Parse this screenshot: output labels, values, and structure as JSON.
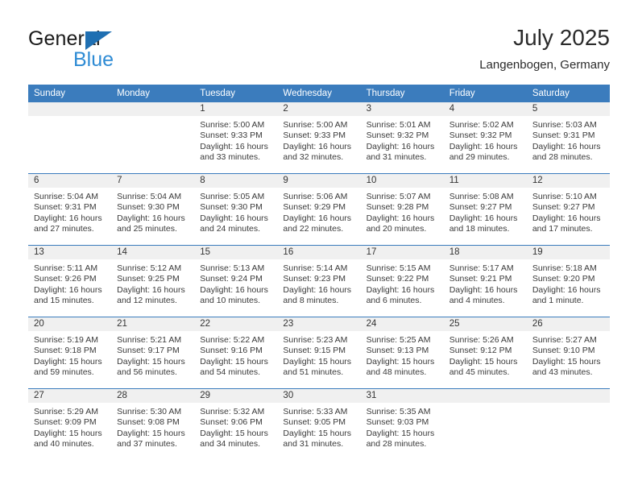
{
  "brand": {
    "word_general": "General",
    "word_blue": "Blue",
    "triangle_color": "#1f6fb2",
    "blue_text_color": "#2e8bd4"
  },
  "header": {
    "title": "July 2025",
    "location": "Langenbogen, Germany",
    "header_bg": "#3b7cbd",
    "header_text": "#ffffff",
    "date_band_bg": "#f0f0f0"
  },
  "weekday_headers": [
    "Sunday",
    "Monday",
    "Tuesday",
    "Wednesday",
    "Thursday",
    "Friday",
    "Saturday"
  ],
  "weeks": [
    [
      {
        "empty": true
      },
      {
        "empty": true
      },
      {
        "day": "1",
        "sunrise": "Sunrise: 5:00 AM",
        "sunset": "Sunset: 9:33 PM",
        "daylight": "Daylight: 16 hours and 33 minutes."
      },
      {
        "day": "2",
        "sunrise": "Sunrise: 5:00 AM",
        "sunset": "Sunset: 9:33 PM",
        "daylight": "Daylight: 16 hours and 32 minutes."
      },
      {
        "day": "3",
        "sunrise": "Sunrise: 5:01 AM",
        "sunset": "Sunset: 9:32 PM",
        "daylight": "Daylight: 16 hours and 31 minutes."
      },
      {
        "day": "4",
        "sunrise": "Sunrise: 5:02 AM",
        "sunset": "Sunset: 9:32 PM",
        "daylight": "Daylight: 16 hours and 29 minutes."
      },
      {
        "day": "5",
        "sunrise": "Sunrise: 5:03 AM",
        "sunset": "Sunset: 9:31 PM",
        "daylight": "Daylight: 16 hours and 28 minutes."
      }
    ],
    [
      {
        "day": "6",
        "sunrise": "Sunrise: 5:04 AM",
        "sunset": "Sunset: 9:31 PM",
        "daylight": "Daylight: 16 hours and 27 minutes."
      },
      {
        "day": "7",
        "sunrise": "Sunrise: 5:04 AM",
        "sunset": "Sunset: 9:30 PM",
        "daylight": "Daylight: 16 hours and 25 minutes."
      },
      {
        "day": "8",
        "sunrise": "Sunrise: 5:05 AM",
        "sunset": "Sunset: 9:30 PM",
        "daylight": "Daylight: 16 hours and 24 minutes."
      },
      {
        "day": "9",
        "sunrise": "Sunrise: 5:06 AM",
        "sunset": "Sunset: 9:29 PM",
        "daylight": "Daylight: 16 hours and 22 minutes."
      },
      {
        "day": "10",
        "sunrise": "Sunrise: 5:07 AM",
        "sunset": "Sunset: 9:28 PM",
        "daylight": "Daylight: 16 hours and 20 minutes."
      },
      {
        "day": "11",
        "sunrise": "Sunrise: 5:08 AM",
        "sunset": "Sunset: 9:27 PM",
        "daylight": "Daylight: 16 hours and 18 minutes."
      },
      {
        "day": "12",
        "sunrise": "Sunrise: 5:10 AM",
        "sunset": "Sunset: 9:27 PM",
        "daylight": "Daylight: 16 hours and 17 minutes."
      }
    ],
    [
      {
        "day": "13",
        "sunrise": "Sunrise: 5:11 AM",
        "sunset": "Sunset: 9:26 PM",
        "daylight": "Daylight: 16 hours and 15 minutes."
      },
      {
        "day": "14",
        "sunrise": "Sunrise: 5:12 AM",
        "sunset": "Sunset: 9:25 PM",
        "daylight": "Daylight: 16 hours and 12 minutes."
      },
      {
        "day": "15",
        "sunrise": "Sunrise: 5:13 AM",
        "sunset": "Sunset: 9:24 PM",
        "daylight": "Daylight: 16 hours and 10 minutes."
      },
      {
        "day": "16",
        "sunrise": "Sunrise: 5:14 AM",
        "sunset": "Sunset: 9:23 PM",
        "daylight": "Daylight: 16 hours and 8 minutes."
      },
      {
        "day": "17",
        "sunrise": "Sunrise: 5:15 AM",
        "sunset": "Sunset: 9:22 PM",
        "daylight": "Daylight: 16 hours and 6 minutes."
      },
      {
        "day": "18",
        "sunrise": "Sunrise: 5:17 AM",
        "sunset": "Sunset: 9:21 PM",
        "daylight": "Daylight: 16 hours and 4 minutes."
      },
      {
        "day": "19",
        "sunrise": "Sunrise: 5:18 AM",
        "sunset": "Sunset: 9:20 PM",
        "daylight": "Daylight: 16 hours and 1 minute."
      }
    ],
    [
      {
        "day": "20",
        "sunrise": "Sunrise: 5:19 AM",
        "sunset": "Sunset: 9:18 PM",
        "daylight": "Daylight: 15 hours and 59 minutes."
      },
      {
        "day": "21",
        "sunrise": "Sunrise: 5:21 AM",
        "sunset": "Sunset: 9:17 PM",
        "daylight": "Daylight: 15 hours and 56 minutes."
      },
      {
        "day": "22",
        "sunrise": "Sunrise: 5:22 AM",
        "sunset": "Sunset: 9:16 PM",
        "daylight": "Daylight: 15 hours and 54 minutes."
      },
      {
        "day": "23",
        "sunrise": "Sunrise: 5:23 AM",
        "sunset": "Sunset: 9:15 PM",
        "daylight": "Daylight: 15 hours and 51 minutes."
      },
      {
        "day": "24",
        "sunrise": "Sunrise: 5:25 AM",
        "sunset": "Sunset: 9:13 PM",
        "daylight": "Daylight: 15 hours and 48 minutes."
      },
      {
        "day": "25",
        "sunrise": "Sunrise: 5:26 AM",
        "sunset": "Sunset: 9:12 PM",
        "daylight": "Daylight: 15 hours and 45 minutes."
      },
      {
        "day": "26",
        "sunrise": "Sunrise: 5:27 AM",
        "sunset": "Sunset: 9:10 PM",
        "daylight": "Daylight: 15 hours and 43 minutes."
      }
    ],
    [
      {
        "day": "27",
        "sunrise": "Sunrise: 5:29 AM",
        "sunset": "Sunset: 9:09 PM",
        "daylight": "Daylight: 15 hours and 40 minutes."
      },
      {
        "day": "28",
        "sunrise": "Sunrise: 5:30 AM",
        "sunset": "Sunset: 9:08 PM",
        "daylight": "Daylight: 15 hours and 37 minutes."
      },
      {
        "day": "29",
        "sunrise": "Sunrise: 5:32 AM",
        "sunset": "Sunset: 9:06 PM",
        "daylight": "Daylight: 15 hours and 34 minutes."
      },
      {
        "day": "30",
        "sunrise": "Sunrise: 5:33 AM",
        "sunset": "Sunset: 9:05 PM",
        "daylight": "Daylight: 15 hours and 31 minutes."
      },
      {
        "day": "31",
        "sunrise": "Sunrise: 5:35 AM",
        "sunset": "Sunset: 9:03 PM",
        "daylight": "Daylight: 15 hours and 28 minutes."
      },
      {
        "empty": true
      },
      {
        "empty": true
      }
    ]
  ]
}
